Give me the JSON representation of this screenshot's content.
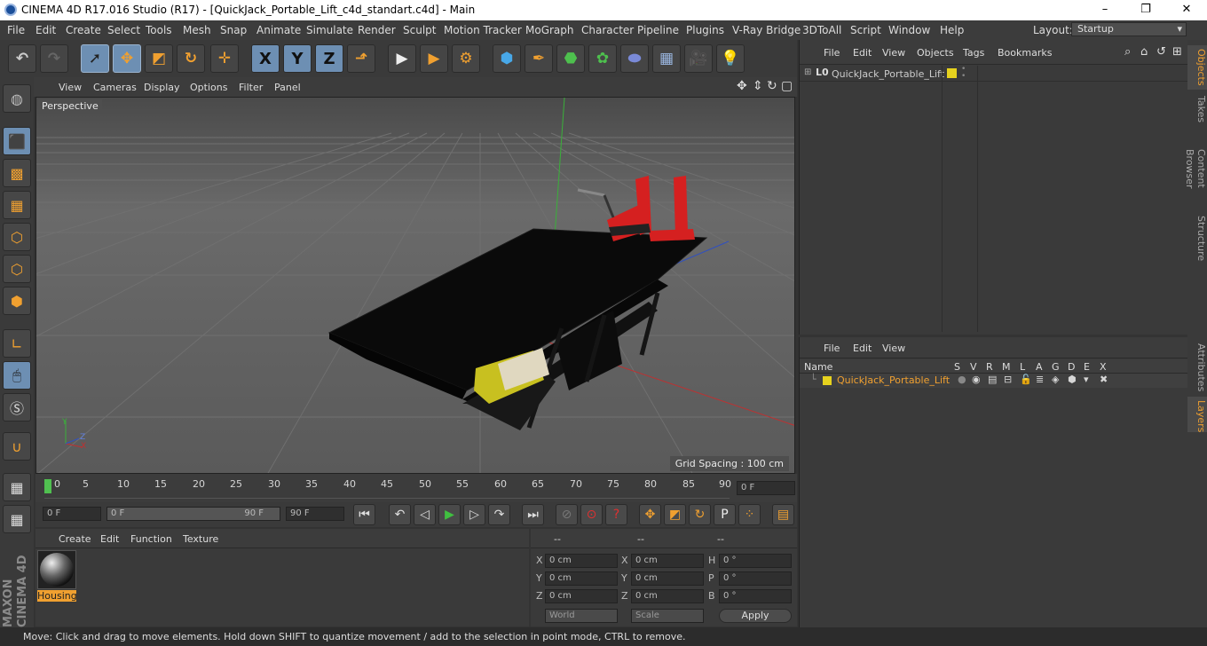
{
  "window": {
    "title": "CINEMA 4D R17.016 Studio (R17) - [QuickJack_Portable_Lift_c4d_standart.c4d] - Main",
    "controls": [
      "–",
      "❐",
      "✕"
    ]
  },
  "menubar": {
    "items": [
      "File",
      "Edit",
      "Create",
      "Select",
      "Tools",
      "Mesh",
      "Snap",
      "Animate",
      "Simulate",
      "Render",
      "Sculpt",
      "Motion Tracker",
      "MoGraph",
      "Character",
      "Pipeline",
      "Plugins",
      "V-Ray Bridge",
      "3DToAll",
      "Script",
      "Window",
      "Help"
    ],
    "layout_label": "Layout:",
    "layout_value": "Startup"
  },
  "toolbar": {
    "axis_x": "X",
    "axis_y": "Y",
    "axis_z": "Z"
  },
  "viewport": {
    "menu": [
      "View",
      "Cameras",
      "Display",
      "Options",
      "Filter",
      "Panel"
    ],
    "camera_label": "Perspective",
    "grid_spacing": "Grid Spacing : 100 cm",
    "axis_y": "Y",
    "axis_x": "X",
    "axis_z": "Z"
  },
  "timeline": {
    "ticks": [
      "0",
      "5",
      "10",
      "15",
      "20",
      "25",
      "30",
      "35",
      "40",
      "45",
      "50",
      "55",
      "60",
      "65",
      "70",
      "75",
      "80",
      "85",
      "90"
    ],
    "current_frame": "0 F"
  },
  "transport": {
    "start_field": "0 F",
    "range_start": "0 F",
    "range_end": "90 F",
    "end_field": "90 F",
    "record_icons": [
      "P"
    ]
  },
  "materials": {
    "menu": [
      "Create",
      "Edit",
      "Function",
      "Texture"
    ],
    "items": [
      {
        "name": "Housing"
      }
    ]
  },
  "coordinates": {
    "headers": [
      "--",
      "--",
      "--"
    ],
    "rows": [
      {
        "a_label": "X",
        "a_val": "0 cm",
        "b_label": "X",
        "b_val": "0 cm",
        "c_label": "H",
        "c_val": "0 °"
      },
      {
        "a_label": "Y",
        "a_val": "0 cm",
        "b_label": "Y",
        "b_val": "0 cm",
        "c_label": "P",
        "c_val": "0 °"
      },
      {
        "a_label": "Z",
        "a_val": "0 cm",
        "b_label": "Z",
        "b_val": "0 cm",
        "c_label": "B",
        "c_val": "0 °"
      }
    ],
    "world_select": "World",
    "scale_select": "Scale",
    "apply_label": "Apply"
  },
  "objects_panel": {
    "menu": [
      "File",
      "Edit",
      "View",
      "Objects",
      "Tags",
      "Bookmarks"
    ],
    "object_name": "QuickJack_Portable_Lift",
    "tag_color": "#e6d21e"
  },
  "layers_panel": {
    "menu": [
      "File",
      "Edit",
      "View"
    ],
    "columns": [
      "Name",
      "S",
      "V",
      "R",
      "M",
      "L",
      "A",
      "G",
      "D",
      "E",
      "X"
    ],
    "layer_name": "QuickJack_Portable_Lift"
  },
  "right_tabs": [
    "Objects",
    "Takes",
    "Content Browser",
    "Structure",
    "Attributes",
    "Layers"
  ],
  "status": "Move: Click and drag to move elements. Hold down SHIFT to quantize movement / add to the selection in point mode, CTRL to remove.",
  "branding": {
    "maxon": "MAXON",
    "product": "CINEMA 4D"
  },
  "colors": {
    "accent": "#f0a030",
    "selection": "#6d8fb3",
    "layer_color": "#e6d21e"
  }
}
